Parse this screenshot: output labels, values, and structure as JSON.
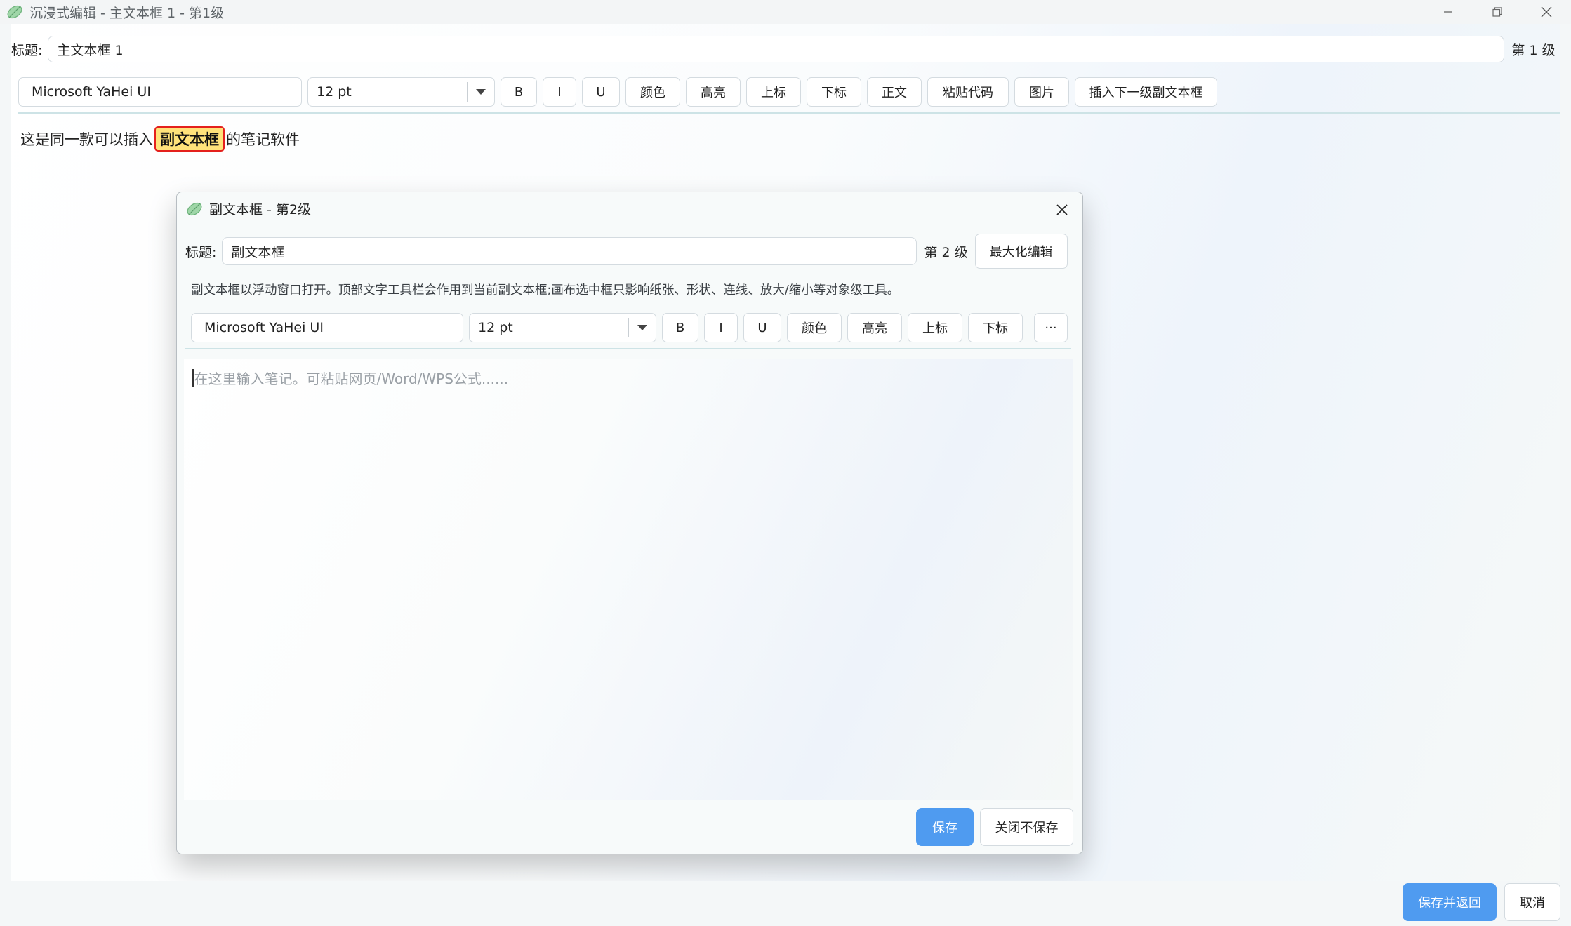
{
  "window": {
    "title": "沉浸式编辑 - 主文本框 1 - 第1级",
    "icon": "leaf-icon"
  },
  "main": {
    "title_label": "标题:",
    "title_value": "主文本框 1",
    "level_label": "第 1 级",
    "toolbar": {
      "font": "Microsoft YaHei UI",
      "size": "12 pt",
      "bold": "B",
      "italic": "I",
      "underline": "U",
      "color": "颜色",
      "highlight": "高亮",
      "superscript": "上标",
      "subscript": "下标",
      "normal": "正文",
      "paste_code": "粘贴代码",
      "image": "图片",
      "insert_sub": "插入下一级副文本框"
    },
    "content": {
      "before": "这是同一款可以插入",
      "chip": "副文本框",
      "after": "的笔记软件"
    },
    "save_return": "保存并返回",
    "cancel": "取消"
  },
  "dialog": {
    "title": "副文本框 - 第2级",
    "title_label": "标题:",
    "title_value": "副文本框",
    "level_label": "第 2 级",
    "maximize": "最大化编辑",
    "hint": "副文本框以浮动窗口打开。顶部文字工具栏会作用到当前副文本框;画布选中框只影响纸张、形状、连线、放大/缩小等对象级工具。",
    "toolbar": {
      "font": "Microsoft YaHei UI",
      "size": "12 pt",
      "bold": "B",
      "italic": "I",
      "underline": "U",
      "color": "颜色",
      "highlight": "高亮",
      "superscript": "上标",
      "subscript": "下标",
      "more": "···"
    },
    "placeholder": "在这里输入笔记。可粘贴网页/Word/WPS公式......",
    "save": "保存",
    "close_nosave": "关闭不保存"
  },
  "colors": {
    "accent": "#4f9bf0",
    "chip_fill": "#ffe27a",
    "chip_border": "#e4201c"
  }
}
